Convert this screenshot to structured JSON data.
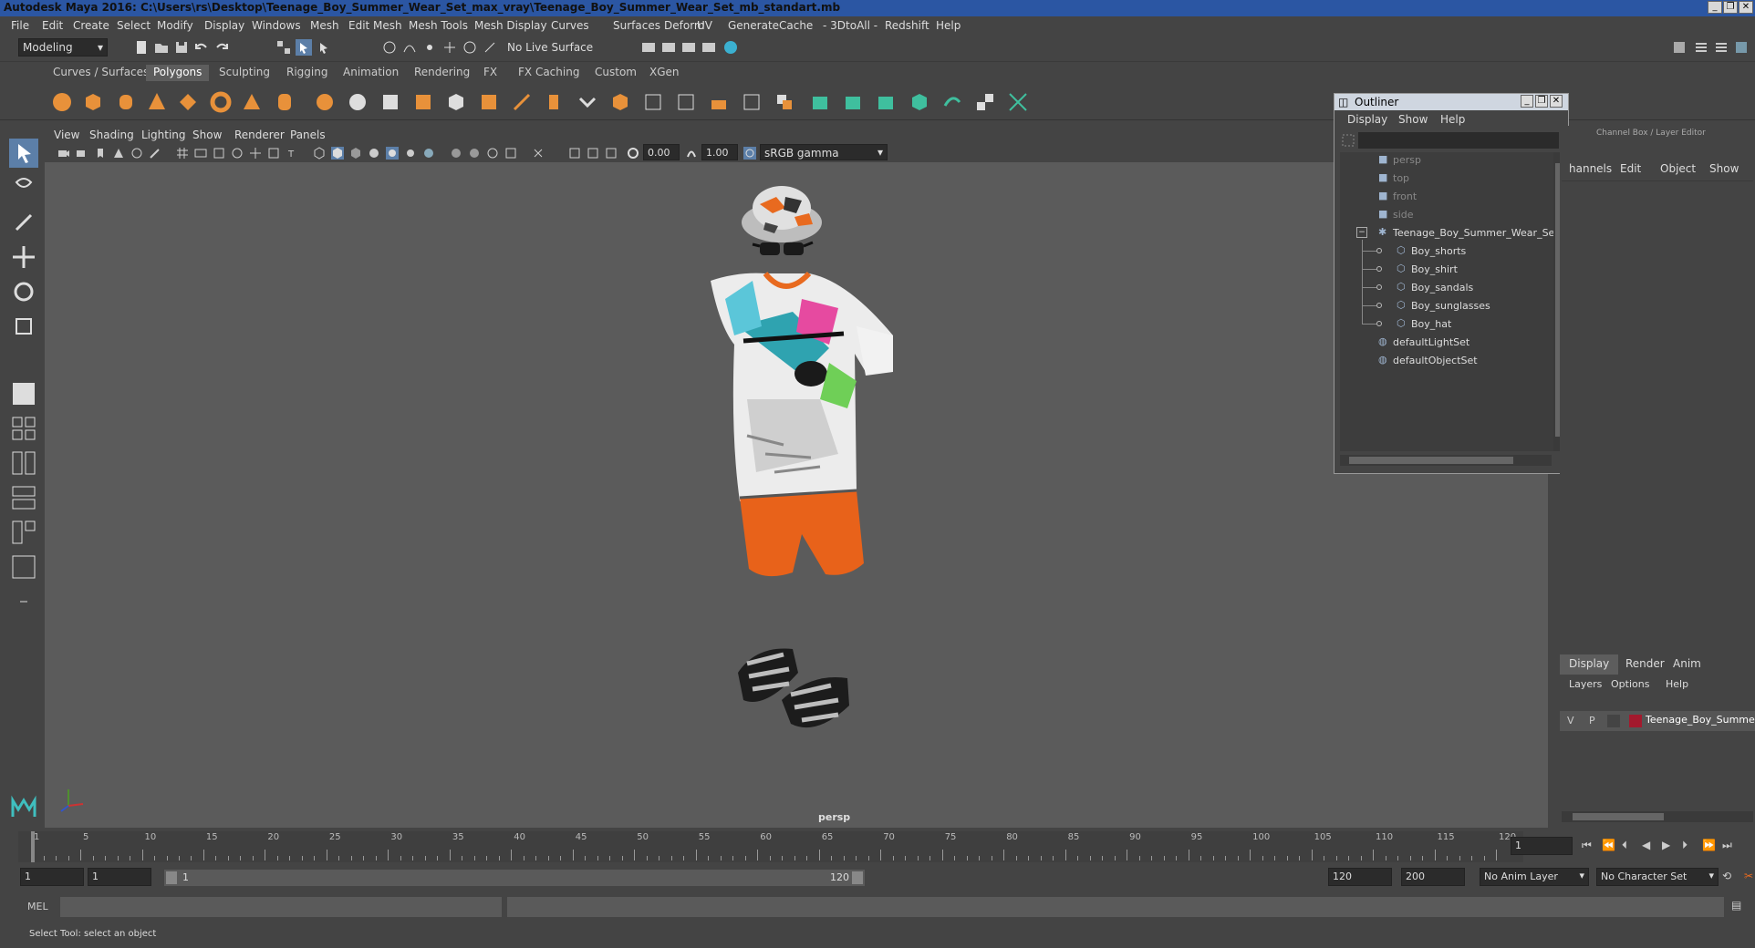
{
  "window": {
    "title": "Autodesk Maya 2016: C:\\Users\\rs\\Desktop\\Teenage_Boy_Summer_Wear_Set_max_vray\\Teenage_Boy_Summer_Wear_Set_mb_standart.mb"
  },
  "menu": [
    "File",
    "Edit",
    "Create",
    "Select",
    "Modify",
    "Display",
    "Windows",
    "Mesh",
    "Edit Mesh",
    "Mesh Tools",
    "Mesh Display",
    "Curves",
    "Surfaces",
    "Deform",
    "UV",
    "Generate",
    "Cache",
    "- 3DtoAll -",
    "Redshift",
    "Help"
  ],
  "status_line": {
    "mode": "Modeling",
    "live_surface": "No Live Surface"
  },
  "shelf_tabs": [
    "Curves / Surfaces",
    "Polygons",
    "Sculpting",
    "Rigging",
    "Animation",
    "Rendering",
    "FX",
    "FX Caching",
    "Custom",
    "XGen"
  ],
  "active_shelf_tab": "Polygons",
  "panel": {
    "menus": [
      "View",
      "Shading",
      "Lighting",
      "Show",
      "Renderer",
      "Panels"
    ],
    "exposure": "0.00",
    "gamma": "1.00",
    "color_space": "sRGB gamma",
    "camera_label": "persp"
  },
  "outliner": {
    "title": "Outliner",
    "menus": [
      "Display",
      "Show",
      "Help"
    ],
    "items": [
      {
        "label": "persp",
        "dim": true
      },
      {
        "label": "top",
        "dim": true
      },
      {
        "label": "front",
        "dim": true
      },
      {
        "label": "side",
        "dim": true
      },
      {
        "label": "Teenage_Boy_Summer_Wear_Set_",
        "dim": false
      },
      {
        "label": "Boy_shorts",
        "dim": false
      },
      {
        "label": "Boy_shirt",
        "dim": false
      },
      {
        "label": "Boy_sandals",
        "dim": false
      },
      {
        "label": "Boy_sunglasses",
        "dim": false
      },
      {
        "label": "Boy_hat",
        "dim": false
      },
      {
        "label": "defaultLightSet",
        "dim": false
      },
      {
        "label": "defaultObjectSet",
        "dim": false
      }
    ]
  },
  "channel_box": {
    "title": "Channel Box / Layer Editor",
    "menus": [
      "hannels",
      "Edit",
      "Object",
      "Show"
    ]
  },
  "layer_editor": {
    "tabs": [
      "Display",
      "Render",
      "Anim"
    ],
    "menus": [
      "Layers",
      "Options",
      "Help"
    ],
    "layer": {
      "v": "V",
      "p": "P",
      "name": "Teenage_Boy_Summer_"
    }
  },
  "time_slider": {
    "ticks": [
      "1",
      "5",
      "10",
      "15",
      "20",
      "25",
      "30",
      "35",
      "40",
      "45",
      "50",
      "55",
      "60",
      "65",
      "70",
      "75",
      "80",
      "85",
      "90",
      "95",
      "100",
      "105",
      "110",
      "115",
      "120"
    ],
    "current_frame": "1"
  },
  "range_slider": {
    "start": "1",
    "start2": "1",
    "range_start_label": "1",
    "range_end_label": "120",
    "end": "120",
    "end2": "200",
    "anim_layer": "No Anim Layer",
    "character_set": "No Character Set"
  },
  "command_line": {
    "label": "MEL"
  },
  "help_line": {
    "text": "Select Tool: select an object"
  }
}
